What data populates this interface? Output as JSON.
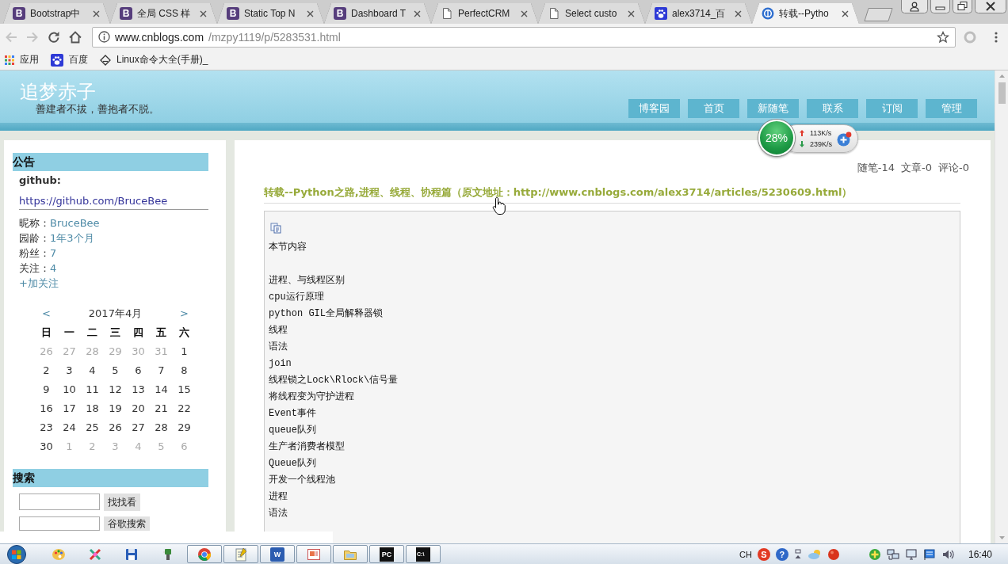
{
  "browser": {
    "tabs": [
      {
        "title": "Bootstrap中",
        "kind": "bootstrap",
        "glyph": "B",
        "selected": false
      },
      {
        "title": "全局 CSS 样",
        "kind": "bootstrap",
        "glyph": "B",
        "selected": false
      },
      {
        "title": "Static Top N",
        "kind": "bootstrap",
        "glyph": "B",
        "selected": false
      },
      {
        "title": "Dashboard T",
        "kind": "bootstrap",
        "glyph": "B",
        "selected": false
      },
      {
        "title": "PerfectCRM",
        "kind": "page",
        "selected": false
      },
      {
        "title": "Select custo",
        "kind": "page",
        "selected": false
      },
      {
        "title": "alex3714_百",
        "kind": "paw",
        "selected": false
      },
      {
        "title": "转载--Pytho",
        "kind": "site",
        "selected": true
      }
    ],
    "nav_buttons": [
      {
        "kind": "back",
        "disabled": true
      },
      {
        "kind": "forward",
        "disabled": true
      },
      {
        "kind": "reload",
        "disabled": false
      },
      {
        "kind": "home",
        "disabled": false
      }
    ],
    "address": {
      "host": "www.cnblogs.com",
      "path": "/mzpy1119/p/5283531.html"
    },
    "bookmarks": [
      {
        "label": "应用",
        "kind": "apps"
      },
      {
        "label": "百度",
        "kind": "paw"
      },
      {
        "label": "Linux命令大全(手册)_",
        "kind": "diamond"
      }
    ]
  },
  "blog": {
    "title": "追梦赤子",
    "subtitle": "善建者不拔，善抱者不脱。",
    "nav": [
      "博客园",
      "首页",
      "新随笔",
      "联系",
      "订阅",
      "管理"
    ]
  },
  "speed_widget": {
    "percent": "28%",
    "upload": "113K/s",
    "download": "239K/s"
  },
  "sidebar": {
    "notice": {
      "heading": "公告",
      "label": "github:",
      "link": "https://github.com/BruceBee",
      "stats": [
        {
          "label": "昵称：",
          "value": "BruceBee"
        },
        {
          "label": "园龄：",
          "value": "1年3个月"
        },
        {
          "label": "粉丝：",
          "value": "7"
        },
        {
          "label": "关注：",
          "value": "4"
        }
      ],
      "follow": "+加关注"
    },
    "calendar": {
      "prev": "<",
      "month": "2017年4月",
      "next": ">",
      "weekdays": [
        "日",
        "一",
        "二",
        "三",
        "四",
        "五",
        "六"
      ],
      "weeks": [
        [
          {
            "day": "26",
            "in_month": false
          },
          {
            "day": "27",
            "in_month": false
          },
          {
            "day": "28",
            "in_month": false
          },
          {
            "day": "29",
            "in_month": false
          },
          {
            "day": "30",
            "in_month": false
          },
          {
            "day": "31",
            "in_month": false
          },
          {
            "day": "1",
            "in_month": true
          }
        ],
        [
          {
            "day": "2",
            "in_month": true
          },
          {
            "day": "3",
            "in_month": true
          },
          {
            "day": "4",
            "in_month": true
          },
          {
            "day": "5",
            "in_month": true
          },
          {
            "day": "6",
            "in_month": true
          },
          {
            "day": "7",
            "in_month": true
          },
          {
            "day": "8",
            "in_month": true
          }
        ],
        [
          {
            "day": "9",
            "in_month": true
          },
          {
            "day": "10",
            "in_month": true
          },
          {
            "day": "11",
            "in_month": true
          },
          {
            "day": "12",
            "in_month": true
          },
          {
            "day": "13",
            "in_month": true
          },
          {
            "day": "14",
            "in_month": true
          },
          {
            "day": "15",
            "in_month": true
          }
        ],
        [
          {
            "day": "16",
            "in_month": true
          },
          {
            "day": "17",
            "in_month": true
          },
          {
            "day": "18",
            "in_month": true
          },
          {
            "day": "19",
            "in_month": true
          },
          {
            "day": "20",
            "in_month": true
          },
          {
            "day": "21",
            "in_month": true
          },
          {
            "day": "22",
            "in_month": true
          }
        ],
        [
          {
            "day": "23",
            "in_month": true
          },
          {
            "day": "24",
            "in_month": true
          },
          {
            "day": "25",
            "in_month": true
          },
          {
            "day": "26",
            "in_month": true
          },
          {
            "day": "27",
            "in_month": true
          },
          {
            "day": "28",
            "in_month": true
          },
          {
            "day": "29",
            "in_month": true
          }
        ],
        [
          {
            "day": "30",
            "in_month": true
          },
          {
            "day": "1",
            "in_month": false
          },
          {
            "day": "2",
            "in_month": false
          },
          {
            "day": "3",
            "in_month": false
          },
          {
            "day": "4",
            "in_month": false
          },
          {
            "day": "5",
            "in_month": false
          },
          {
            "day": "6",
            "in_month": false
          }
        ]
      ]
    },
    "search": {
      "heading": "搜索",
      "buttons": [
        "找找看",
        "谷歌搜索"
      ]
    }
  },
  "post": {
    "stats": [
      "随笔-14",
      "文章-0",
      "评论-0"
    ],
    "title": "转载--Python之路,进程、线程、协程篇（原文地址：http://www.cnblogs.com/alex3714/articles/5230609.html）",
    "heading": "本节内容",
    "lines": [
      "进程、与线程区别",
      "cpu运行原理",
      "python GIL全局解释器锁",
      "线程",
      "语法",
      "join",
      "线程锁之Lock\\Rlock\\信号量",
      "将线程变为守护进程",
      "Event事件",
      "queue队列",
      "生产者消费者模型",
      "Queue队列",
      "开发一个线程池",
      "进程",
      "语法"
    ]
  },
  "taskbar": {
    "apps": [
      {
        "kind": "palette",
        "running": false
      },
      {
        "kind": "tools",
        "running": false
      },
      {
        "kind": "disk",
        "running": false
      },
      {
        "kind": "plug",
        "running": false
      },
      {
        "kind": "wheel",
        "running": true
      },
      {
        "kind": "notepad",
        "running": true
      },
      {
        "kind": "word",
        "glyph": "W",
        "running": true
      },
      {
        "kind": "slides",
        "running": true
      },
      {
        "kind": "folder",
        "running": true
      },
      {
        "kind": "ide",
        "glyph": "PC",
        "running": true
      },
      {
        "kind": "console",
        "glyph": "C:\\",
        "running": true
      }
    ],
    "tray": [
      {
        "kind": "language",
        "glyph": "CH"
      },
      {
        "kind": "sogou",
        "glyph": "S"
      },
      {
        "kind": "help",
        "glyph": "?"
      },
      {
        "kind": "options"
      },
      {
        "kind": "cloud"
      },
      {
        "kind": "ball"
      },
      {
        "kind": "plus"
      },
      {
        "kind": "network"
      },
      {
        "kind": "monitor"
      },
      {
        "kind": "flag"
      },
      {
        "kind": "speaker"
      }
    ],
    "clock": "16:40"
  }
}
